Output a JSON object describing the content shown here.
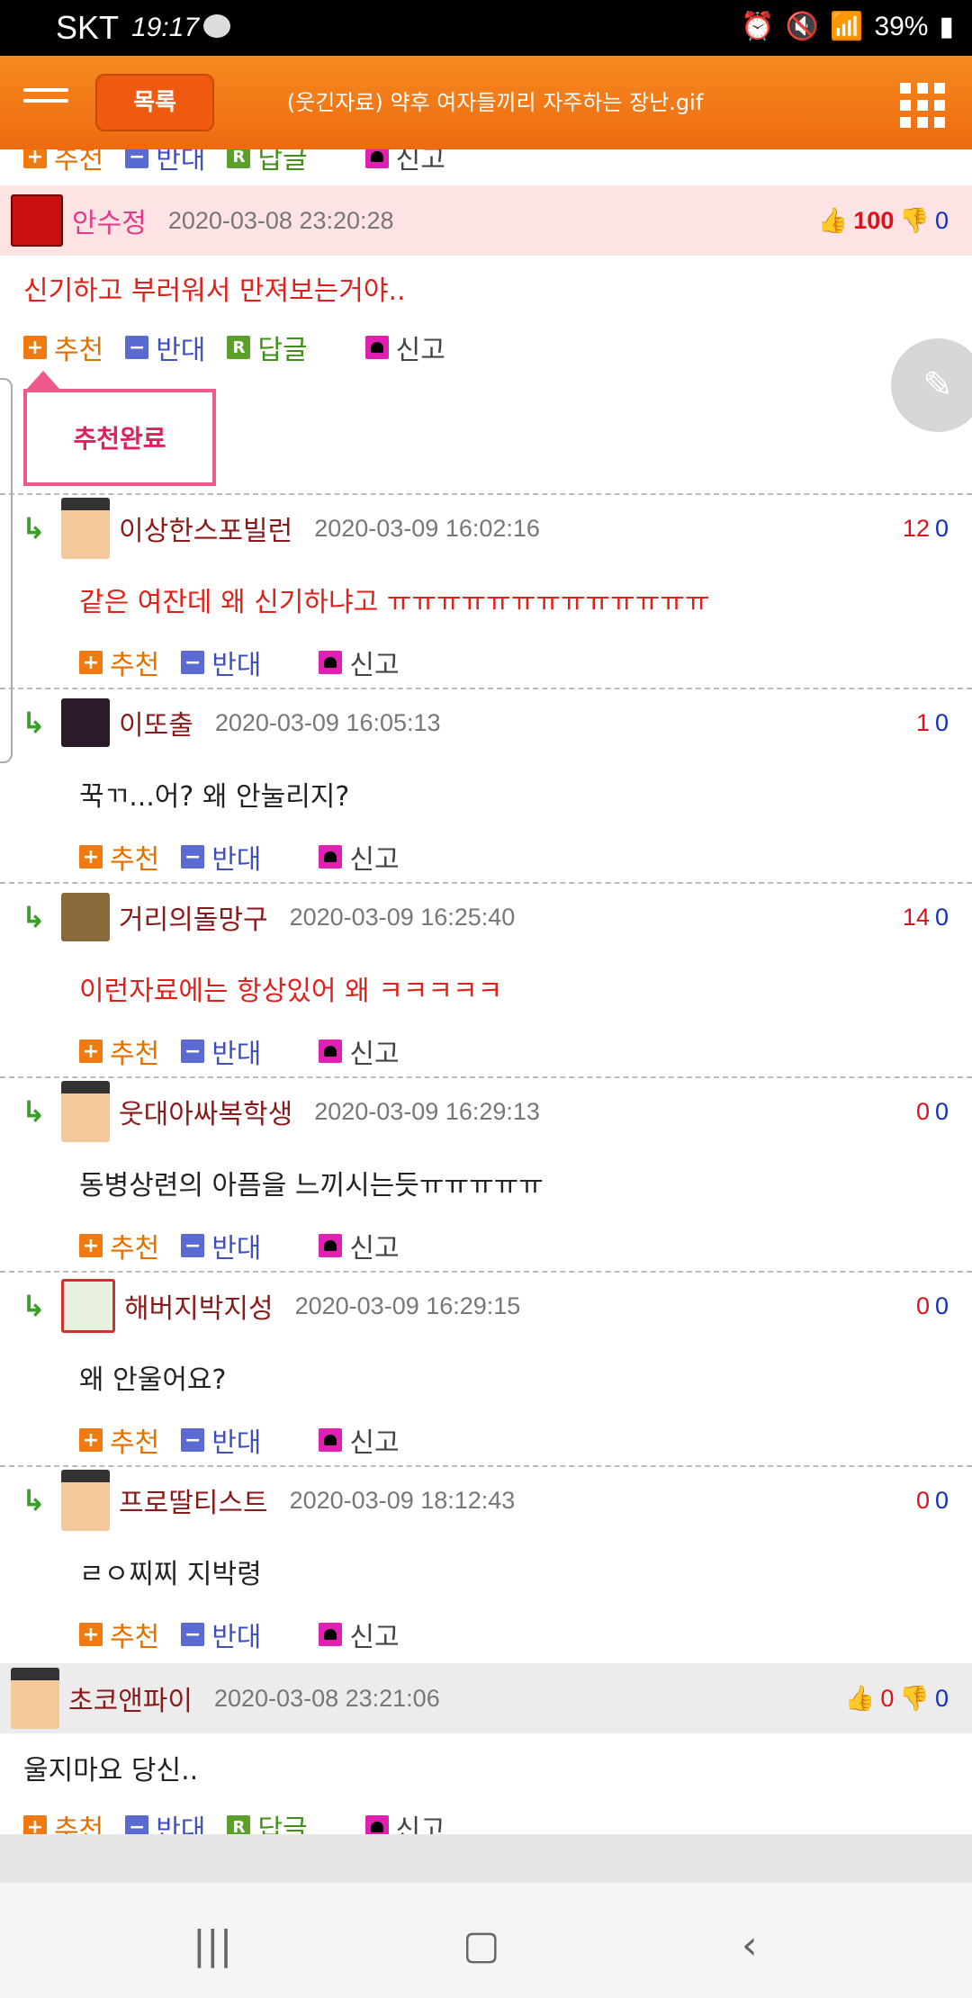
{
  "status_bar": {
    "carrier": "SKT",
    "time": "19:17",
    "battery": "39%"
  },
  "header": {
    "list_button": "목록",
    "title": "(웃긴자료) 약후 여자들끼리 자주하는 장난.gif"
  },
  "actions": {
    "recommend": "추천",
    "oppose": "반대",
    "reply": "답글",
    "report": "신고",
    "r_icon": "R"
  },
  "popup": {
    "text": "추천완료"
  },
  "colors": {
    "brand_orange": "#f07a10",
    "header_orange": "#ee6a10"
  },
  "comments": [
    {
      "author": "안수정",
      "date": "2020-03-08 23:20:28",
      "up": "100",
      "down": "0",
      "text": "신기하고 부러워서 만져보는거야.."
    },
    {
      "author": "초코앤파이",
      "date": "2020-03-08 23:21:06",
      "up": "0",
      "down": "0",
      "text": "울지마요 당신.."
    }
  ],
  "replies": [
    {
      "author": "이상한스포빌런",
      "date": "2020-03-09 16:02:16",
      "up": "12",
      "down": "0",
      "text": "같은 여잔데 왜 신기하냐고 ㅠㅠㅠㅠㅠㅠㅠㅠㅠㅠㅠㅠㅠ"
    },
    {
      "author": "이또출",
      "date": "2020-03-09 16:05:13",
      "up": "1",
      "down": "0",
      "text": "꾹ㄲ...어? 왜 안눌리지?"
    },
    {
      "author": "거리의돌망구",
      "date": "2020-03-09 16:25:40",
      "up": "14",
      "down": "0",
      "text": "이런자료에는 항상있어 왜 ㅋㅋㅋㅋㅋ"
    },
    {
      "author": "웃대아싸복학생",
      "date": "2020-03-09 16:29:13",
      "up": "0",
      "down": "0",
      "text": "동병상련의 아픔을 느끼시는듯ㅠㅠㅠㅠㅠ"
    },
    {
      "author": "해버지박지성",
      "date": "2020-03-09 16:29:15",
      "up": "0",
      "down": "0",
      "text": "왜 안울어요?"
    },
    {
      "author": "프로딸티스트",
      "date": "2020-03-09 18:12:43",
      "up": "0",
      "down": "0",
      "text": "ㄹㅇ찌찌 지박령"
    }
  ]
}
